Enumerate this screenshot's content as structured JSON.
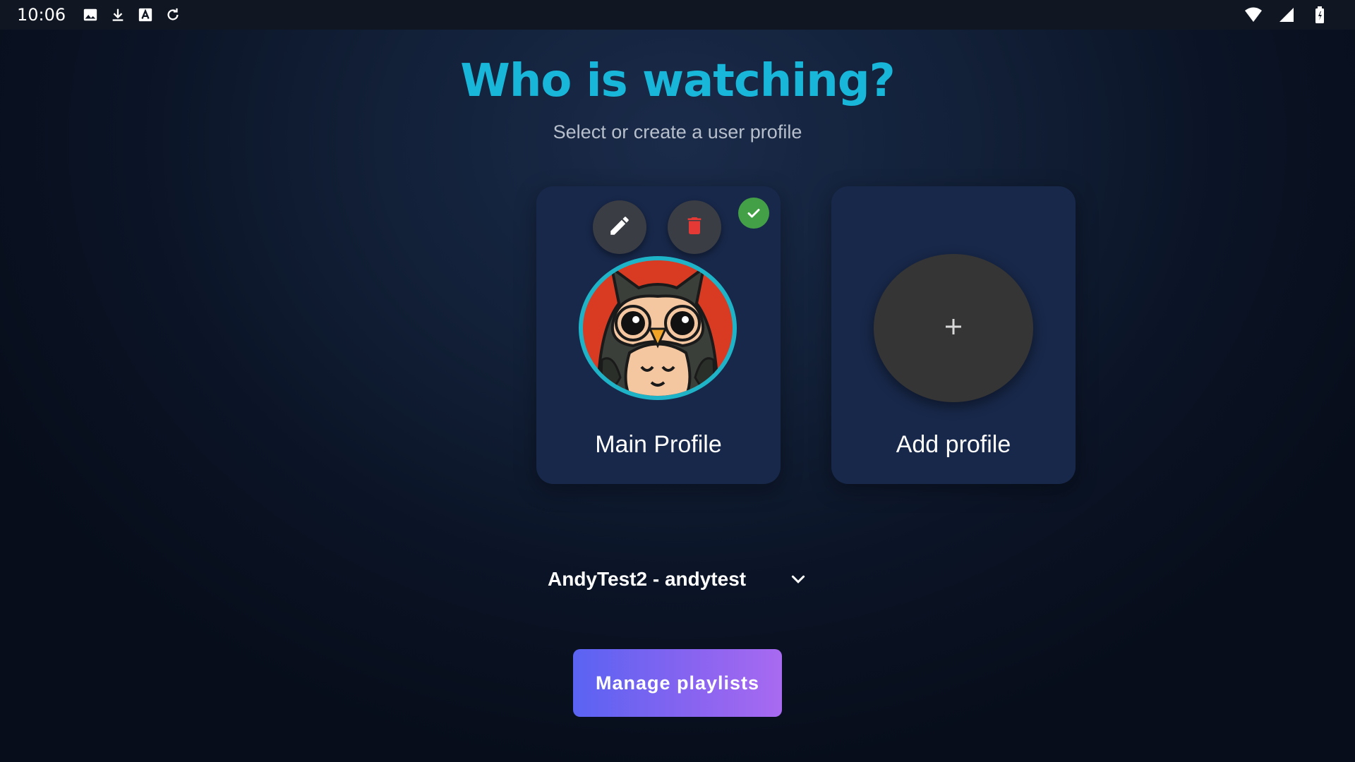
{
  "status_bar": {
    "time": "10:06",
    "left_icons": [
      "image-icon",
      "download-icon",
      "text-a-icon",
      "sync-icon"
    ],
    "right_icons": [
      "wifi-icon",
      "signal-icon",
      "battery-icon"
    ]
  },
  "header": {
    "title": "Who is watching?",
    "subtitle": "Select or create a user profile"
  },
  "profiles": [
    {
      "name": "Main Profile",
      "selected": true,
      "avatar": "owl-avatar-icon",
      "actions": [
        "edit-icon",
        "delete-icon"
      ]
    }
  ],
  "add_profile": {
    "label": "Add profile",
    "icon": "plus-icon"
  },
  "account_selector": {
    "value": "AndyTest2 - andytest"
  },
  "manage_button": {
    "label": "Manage playlists"
  },
  "colors": {
    "title": "#18b7d9",
    "card": "#18284a",
    "delete": "#e53935",
    "selected_badge": "#43a047",
    "button_gradient_start": "#5a63f2",
    "button_gradient_end": "#a86af0"
  }
}
